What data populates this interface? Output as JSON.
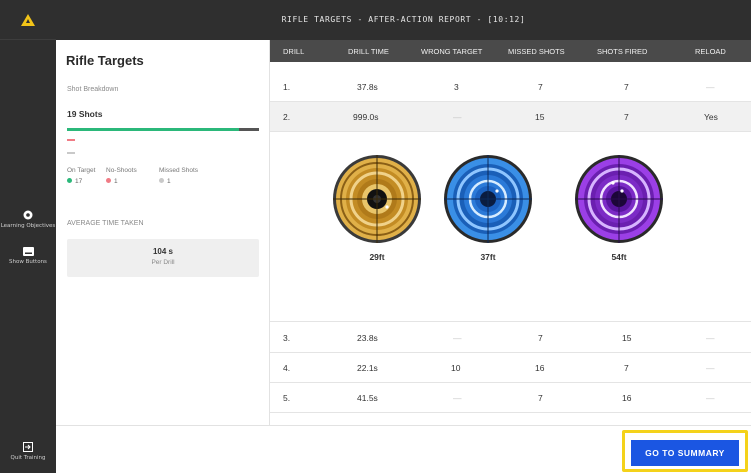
{
  "header": {
    "title": "RIFLE TARGETS - AFTER-ACTION REPORT - [10:12]"
  },
  "sidebar": {
    "learning_objectives": "Learning Objectives",
    "show_buttons": "Show Buttons",
    "quit_training": "Quit Training"
  },
  "panel": {
    "title": "Rifle Targets",
    "shot_breakdown_label": "Shot Breakdown",
    "shots_total": "19 Shots",
    "on_target_fraction": 0.895,
    "legend": [
      {
        "label": "On Target",
        "value": "17",
        "color": "#2bb87a"
      },
      {
        "label": "No-Shoots",
        "value": "1",
        "color": "#f07b85"
      },
      {
        "label": "Missed Shots",
        "value": "1",
        "color": "#c9c9c9"
      }
    ],
    "avg_label": "AVERAGE TIME TAKEN",
    "avg_value": "104 s",
    "avg_unit": "Per Drill"
  },
  "table": {
    "columns": [
      "DRILL",
      "DRILL TIME",
      "WRONG TARGET",
      "MISSED SHOTS",
      "SHOTS FIRED",
      "RELOAD"
    ],
    "rows": [
      {
        "drill": "1.",
        "time": "37.8s",
        "wrong": "3",
        "missed": "7",
        "fired": "7",
        "reload": "—"
      },
      {
        "drill": "2.",
        "time": "999.0s",
        "wrong": "—",
        "missed": "15",
        "fired": "7",
        "reload": "Yes"
      },
      {
        "drill": "3.",
        "time": "23.8s",
        "wrong": "—",
        "missed": "7",
        "fired": "15",
        "reload": "—"
      },
      {
        "drill": "4.",
        "time": "22.1s",
        "wrong": "10",
        "missed": "16",
        "fired": "7",
        "reload": "—"
      },
      {
        "drill": "5.",
        "time": "41.5s",
        "wrong": "—",
        "missed": "7",
        "fired": "16",
        "reload": "—"
      }
    ],
    "targets": [
      {
        "distance": "29ft",
        "color": "#d4a033"
      },
      {
        "distance": "37ft",
        "color": "#2f86e0"
      },
      {
        "distance": "54ft",
        "color": "#8a2fd6"
      }
    ]
  },
  "footer": {
    "summary_button": "GO TO SUMMARY"
  },
  "colors": {
    "accent": "#1b56e2",
    "highlight": "#f4d21a",
    "on_target": "#2bb87a"
  }
}
